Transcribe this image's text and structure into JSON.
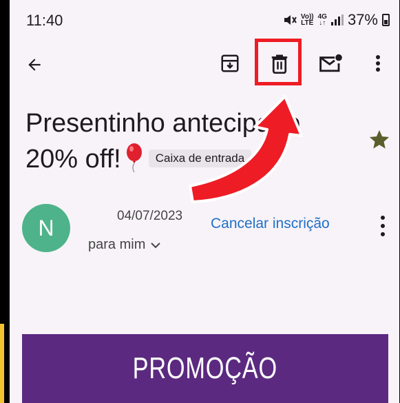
{
  "status_bar": {
    "time": "11:40",
    "volte_top": "Vo))",
    "volte_bottom": "LTE",
    "network_top": "4G",
    "network_bottom": "↓↑",
    "battery_percent": "37%"
  },
  "toolbar": {
    "back_icon": "arrow-back-icon",
    "archive_icon": "archive-icon",
    "delete_icon": "trash-icon",
    "mark_unread_icon": "mark-unread-icon",
    "more_icon": "more-vert-icon"
  },
  "email": {
    "subject_line1": "Presentinho antecipado",
    "subject_line2": "20% off!",
    "label": "Caixa de entrada",
    "starred": true,
    "sender_initial": "N",
    "date": "04/07/2023",
    "recipient": "para mim",
    "unsubscribe": "Cancelar inscrição",
    "banner_text": "PROMOÇÃO"
  },
  "annotation": {
    "highlight_color": "#ee1c25"
  },
  "colors": {
    "background": "#f8f3f9",
    "avatar": "#4eb38a",
    "link": "#1f6fc6",
    "banner": "#5b2a80",
    "star": "#5b5e2a"
  }
}
